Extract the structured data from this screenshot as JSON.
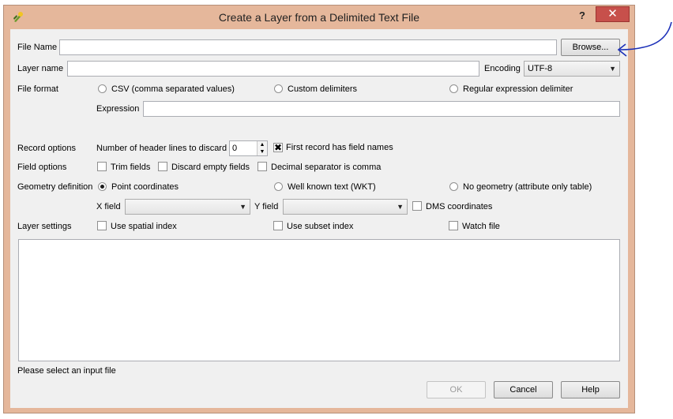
{
  "window": {
    "title": "Create a Layer from a Delimited Text File",
    "help_label": "?",
    "close_label": "✕"
  },
  "file": {
    "label": "File Name",
    "value": "",
    "browse_label": "Browse..."
  },
  "layer": {
    "label": "Layer name",
    "value": "",
    "encoding_label": "Encoding",
    "encoding_value": "UTF-8"
  },
  "file_format": {
    "label": "File format",
    "options": [
      "CSV (comma separated values)",
      "Custom delimiters",
      "Regular expression delimiter"
    ],
    "expression_label": "Expression",
    "expression_value": ""
  },
  "record_options": {
    "label": "Record options",
    "header_lines_label": "Number of header lines to discard",
    "header_lines_value": "0",
    "first_record_label": "First record has field names",
    "first_record_checked": true
  },
  "field_options": {
    "label": "Field options",
    "trim_label": "Trim fields",
    "discard_label": "Discard empty fields",
    "decimal_label": "Decimal separator is comma"
  },
  "geometry": {
    "label": "Geometry definition",
    "options": [
      "Point coordinates",
      "Well known text (WKT)",
      "No geometry (attribute only table)"
    ],
    "selected": "Point coordinates",
    "x_label": "X field",
    "x_value": "",
    "y_label": "Y field",
    "y_value": "",
    "dms_label": "DMS coordinates"
  },
  "layer_settings": {
    "label": "Layer settings",
    "spatial_label": "Use spatial index",
    "subset_label": "Use subset index",
    "watch_label": "Watch file"
  },
  "status": "Please select an input file",
  "buttons": {
    "ok": "OK",
    "cancel": "Cancel",
    "help": "Help"
  },
  "colors": {
    "title_bar": "#e5b79b",
    "close_button": "#c7504b",
    "annotation_arrow": "#1b2fb8"
  }
}
